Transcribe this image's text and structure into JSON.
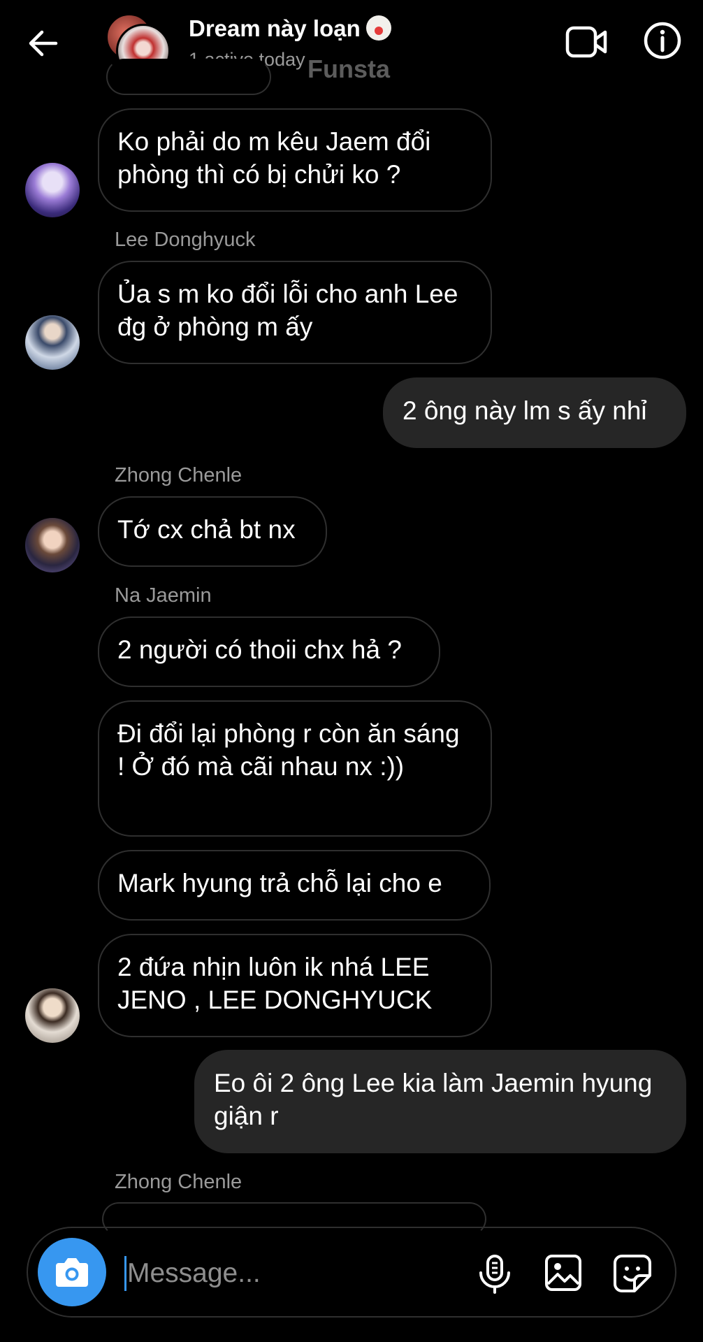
{
  "header": {
    "title": "Dream này loạn",
    "subtitle": "1 active today",
    "watermark": "Funsta"
  },
  "icons": {
    "back": "arrow-left-icon",
    "video": "video-camera-icon",
    "info": "info-icon",
    "camera": "camera-icon",
    "mic": "microphone-icon",
    "gallery": "image-icon",
    "sticker": "sticker-icon"
  },
  "colors": {
    "accent": "#3797f0",
    "outgoing_bubble": "#262626",
    "bubble_border": "#2f2f2f"
  },
  "messages": [
    {
      "text": "Ko phải do m kêu Jaem đổi phòng thì có bị chửi ko ?"
    },
    {
      "sender": "Lee Donghyuck",
      "text": "Ủa s m ko đổi lỗi cho anh Lee đg ở phòng m ấy"
    },
    {
      "text": "2 ông này lm s ấy nhỉ"
    },
    {
      "sender": "Zhong Chenle",
      "text": "Tớ cx chả bt nx"
    },
    {
      "sender": "Na Jaemin",
      "text": "2 người có thoii chx hả ?"
    },
    {
      "text": "Đi đổi lại phòng r còn ăn sáng ! Ở đó mà cãi nhau nx :))"
    },
    {
      "text": "Mark hyung trả chỗ lại cho e"
    },
    {
      "text": "2 đứa nhịn luôn ik nhá LEE JENO , LEE DONGHYUCK"
    },
    {
      "text": "Eo ôi 2 ông Lee kia làm Jaemin hyung giận r"
    },
    {
      "sender": "Zhong Chenle"
    }
  ],
  "composer": {
    "placeholder": "Message..."
  }
}
